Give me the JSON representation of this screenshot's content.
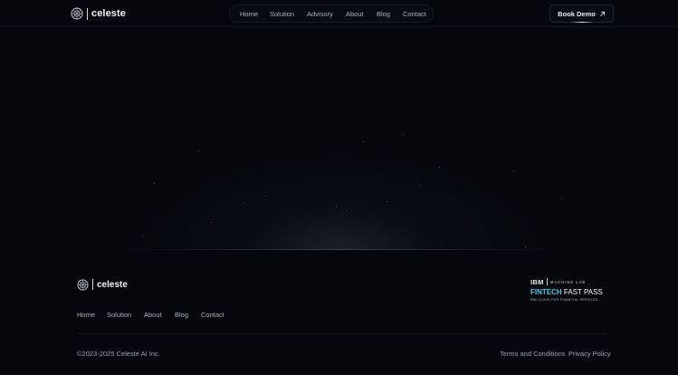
{
  "header": {
    "logo_text": "celeste",
    "nav": [
      "Home",
      "Solution",
      "Advisory",
      "About",
      "Blog",
      "Contact"
    ],
    "cta_label": "Book Demo"
  },
  "footer": {
    "logo_text": "celeste",
    "partner": {
      "brand": "IBM",
      "program": "MACHINE LAB",
      "title_bold": "FINTECH",
      "title_light": "FAST PASS",
      "subtitle": "IBM CLOUD FOR FINANCIAL SERVICES"
    },
    "nav": [
      "Home",
      "Solution",
      "About",
      "Blog",
      "Contact"
    ],
    "copyright": "©2023-2025 Celeste AI Inc.",
    "terms": "Terms and Conditions",
    "privacy": "Privacy Policy"
  },
  "colors": {
    "background": "#05070d",
    "accent_cyan": "#48c9e8",
    "accent_red": "#e24b5c"
  }
}
